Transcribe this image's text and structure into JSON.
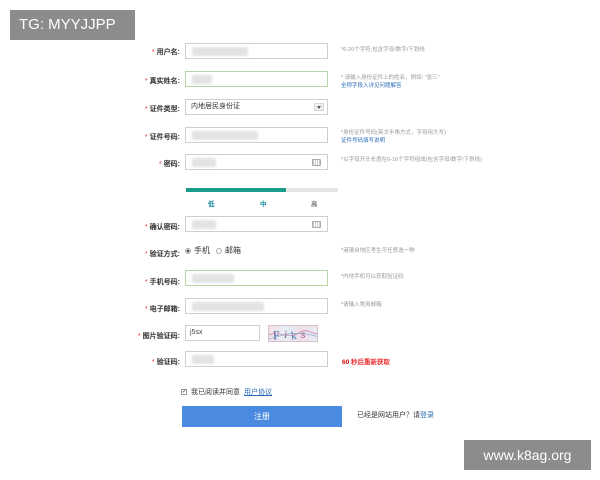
{
  "watermarks": {
    "top": "TG: MYYJJPP",
    "bottom": "www.k8ag.org"
  },
  "form": {
    "username": {
      "label": "用户名:",
      "hint": "*6-20个字符,包含字母/数字/下划线"
    },
    "realname": {
      "label": "真实姓名:",
      "hint": "* 请输入身份证件上的姓名，例如: \"张三\"",
      "hint_link": "全称字段入详见问题解答"
    },
    "idtype": {
      "label": "证件类型:",
      "value": "内地居民身份证"
    },
    "idnumber": {
      "label": "证件号码:",
      "hint": "*身份证件号码(英文半角方式，字母用大写)",
      "hint_link": "证件号码填写说明"
    },
    "password": {
      "label": "密码:",
      "hint": "*以字母开头长度在6-16个字符组成(包含字母/数字/下划线)"
    },
    "strength": {
      "low": "低",
      "mid": "中",
      "high": "高",
      "level": 0.66
    },
    "confirm": {
      "label": "确认密码:"
    },
    "verify_method": {
      "label": "验证方式:",
      "phone": "手机",
      "email": "邮箱",
      "hint": "*港澳台地区考生可任意选一种"
    },
    "phone": {
      "label": "手机号码:",
      "hint": "*内地手机可以获取验证码"
    },
    "email": {
      "label": "电子邮箱:",
      "hint": "*请输入常用邮箱"
    },
    "captcha": {
      "label": "图片验证码:",
      "value": "j5sx"
    },
    "sms_code": {
      "label": "验证码:",
      "countdown": "60",
      "countdown_text": "秒后重新获取"
    },
    "agree": {
      "check": "✓",
      "text": "我已阅读并同意",
      "link": "用户协议"
    },
    "submit": "注册",
    "login": {
      "text": "已经是网站用户？请",
      "link": "登录"
    }
  }
}
